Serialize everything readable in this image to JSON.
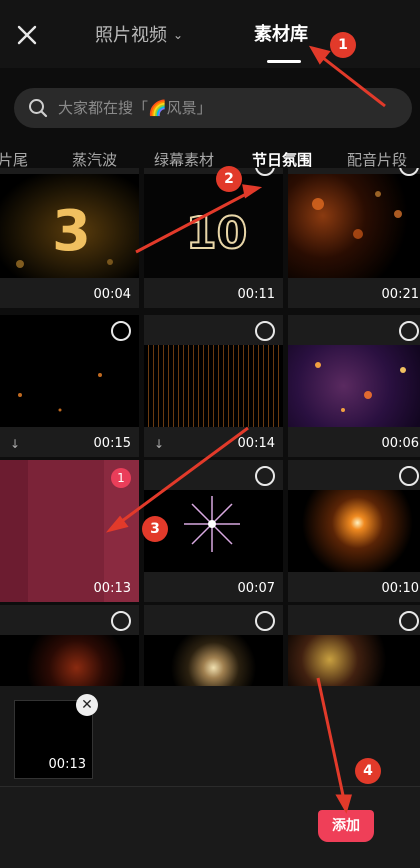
{
  "header": {
    "tab_source": "照片视频",
    "tab_library": "素材库"
  },
  "search": {
    "placeholder": "大家都在搜「🌈风景」"
  },
  "categories": [
    "片尾",
    "蒸汽波",
    "绿幕素材",
    "节日氛围",
    "配音片段"
  ],
  "active_category": "节日氛围",
  "grid": [
    {
      "duration": "00:04",
      "thumb": "gold-number-3",
      "download": false
    },
    {
      "duration": "00:11",
      "thumb": "sparkle-number-10",
      "download": false
    },
    {
      "duration": "00:21",
      "thumb": "orange-bokeh",
      "download": false
    },
    {
      "duration": "00:15",
      "thumb": "dark-embers",
      "download": true
    },
    {
      "duration": "00:14",
      "thumb": "gold-rain",
      "download": true
    },
    {
      "duration": "00:06",
      "thumb": "purple-particles",
      "download": false
    },
    {
      "duration": "00:13",
      "thumb": "pink-sparkles",
      "selected": true,
      "badge": "1"
    },
    {
      "duration": "00:07",
      "thumb": "purple-firework",
      "download": false
    },
    {
      "duration": "00:10",
      "thumb": "orange-light-burst",
      "download": false
    },
    {
      "duration": "",
      "thumb": "red-firework",
      "download": false
    },
    {
      "duration": "",
      "thumb": "gold-firework",
      "download": false
    },
    {
      "duration": "",
      "thumb": "multi-fireworks",
      "download": false
    }
  ],
  "selected_tray": {
    "duration": "00:13",
    "remove_icon": "✕"
  },
  "add_button": {
    "label": "添加"
  },
  "annotations": [
    "1",
    "2",
    "3",
    "4"
  ],
  "colors": {
    "accent": "#ef3f58",
    "annotation": "#e23a2a"
  }
}
